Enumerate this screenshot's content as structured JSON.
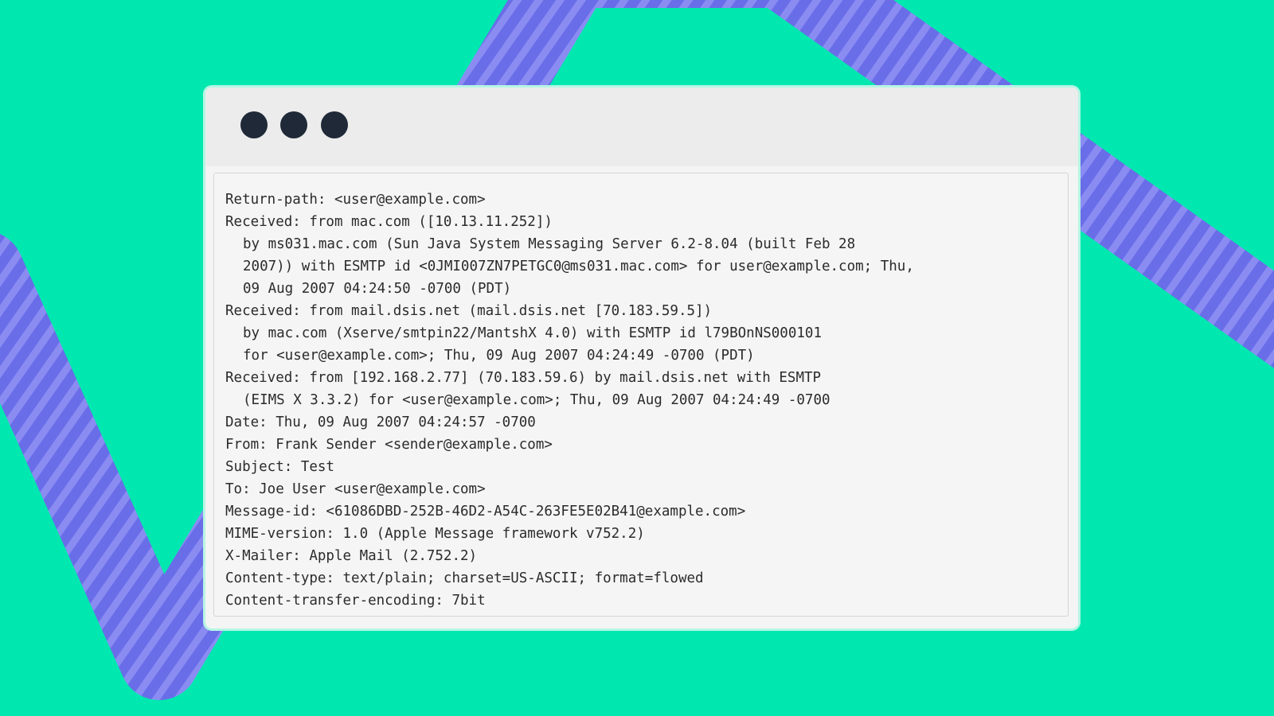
{
  "window": {
    "traffic_lights": [
      "dot-1",
      "dot-2",
      "dot-3"
    ],
    "colors": {
      "background": "#00e8b0",
      "stripe": "#6b6ee6",
      "dot": "#1f2937"
    }
  },
  "email_headers": [
    {
      "text": "Return-path: <user@example.com>",
      "indent": false
    },
    {
      "text": "Received: from mac.com ([10.13.11.252])",
      "indent": false
    },
    {
      "text": "by ms031.mac.com (Sun Java System Messaging Server 6.2-8.04 (built Feb 28",
      "indent": true
    },
    {
      "text": "2007)) with ESMTP id <0JMI007ZN7PETGC0@ms031.mac.com> for user@example.com; Thu,",
      "indent": true
    },
    {
      "text": "09 Aug 2007 04:24:50 -0700 (PDT)",
      "indent": true
    },
    {
      "text": "Received: from mail.dsis.net (mail.dsis.net [70.183.59.5])",
      "indent": false
    },
    {
      "text": "by mac.com (Xserve/smtpin22/MantshX 4.0) with ESMTP id l79BOnNS000101",
      "indent": true
    },
    {
      "text": "for <user@example.com>; Thu, 09 Aug 2007 04:24:49 -0700 (PDT)",
      "indent": true
    },
    {
      "text": "Received: from [192.168.2.77] (70.183.59.6) by mail.dsis.net with ESMTP",
      "indent": false
    },
    {
      "text": "(EIMS X 3.3.2) for <user@example.com>; Thu, 09 Aug 2007 04:24:49 -0700",
      "indent": true
    },
    {
      "text": "Date: Thu, 09 Aug 2007 04:24:57 -0700",
      "indent": false
    },
    {
      "text": "From: Frank Sender <sender@example.com>",
      "indent": false
    },
    {
      "text": "Subject: Test",
      "indent": false
    },
    {
      "text": "To: Joe User <user@example.com>",
      "indent": false
    },
    {
      "text": "Message-id: <61086DBD-252B-46D2-A54C-263FE5E02B41@example.com>",
      "indent": false
    },
    {
      "text": "MIME-version: 1.0 (Apple Message framework v752.2)",
      "indent": false
    },
    {
      "text": "X-Mailer: Apple Mail (2.752.2)",
      "indent": false
    },
    {
      "text": "Content-type: text/plain; charset=US-ASCII; format=flowed",
      "indent": false
    },
    {
      "text": "Content-transfer-encoding: 7bit",
      "indent": false
    }
  ]
}
